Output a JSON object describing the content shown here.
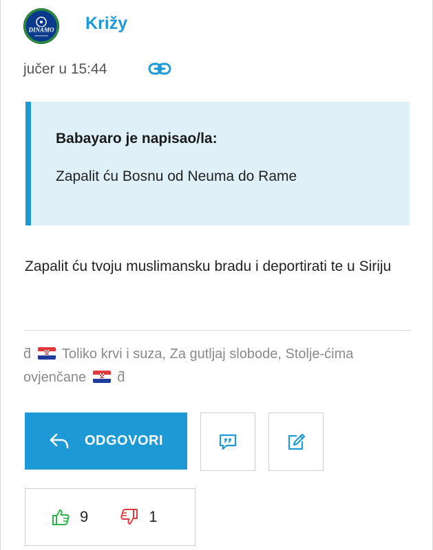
{
  "post": {
    "author": "Križy",
    "timestamp": "jučer u 15:44",
    "avatar_icon": "dinamo-club-badge",
    "avatar_text": "DINAMO"
  },
  "quote": {
    "author_line": "Babayaro je napisao/la:",
    "text": "Zapalit ću Bosnu od Neuma do Rame"
  },
  "body": {
    "text": "Zapalit ću tvoju muslimansku bradu i deportirati te u Siriju"
  },
  "signature": {
    "mark": "ƌ",
    "text": "Toliko krvi i suza, Za gutljaj slobode, Stolje-ćima ovjenčane",
    "flag_icon": "croatia-flag-icon"
  },
  "actions": {
    "reply_label": "ODGOVORI",
    "reply_icon": "reply-arrow-icon",
    "quote_icon": "quote-bubble-icon",
    "edit_icon": "edit-icon"
  },
  "votes": {
    "up_count": "9",
    "down_count": "1",
    "up_color": "#2db34a",
    "down_color": "#e0393e"
  },
  "colors": {
    "accent": "#1d9ad6",
    "quote_background": "#dff0f9",
    "signature_text": "#8a8a8a"
  }
}
